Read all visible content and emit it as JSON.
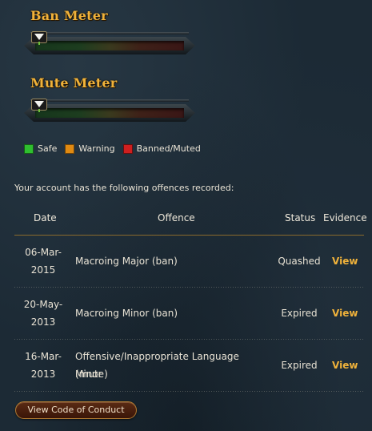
{
  "ban_meter": {
    "title": "Ban Meter",
    "level": 0
  },
  "mute_meter": {
    "title": "Mute Meter",
    "level": 0
  },
  "legend": [
    {
      "label": "Safe",
      "color": "#2fbf2f"
    },
    {
      "label": "Warning",
      "color": "#e08a12"
    },
    {
      "label": "Banned/Muted",
      "color": "#cf1f1f"
    }
  ],
  "intro_text": "Your account has the following offences recorded:",
  "table": {
    "headers": {
      "date": "Date",
      "offence": "Offence",
      "status": "Status",
      "evidence": "Evidence"
    },
    "rows": [
      {
        "date_line1": "06-Mar-",
        "date_line2": "2015",
        "offence_line1": "Macroing Major (ban)",
        "offence_line2": "",
        "status": "Quashed",
        "evidence": "View"
      },
      {
        "date_line1": "20-May-",
        "date_line2": "2013",
        "offence_line1": "Macroing Minor (ban)",
        "offence_line2": "",
        "status": "Expired",
        "evidence": "View"
      },
      {
        "date_line1": "16-Mar-",
        "date_line2": "2013",
        "offence_line1": "Offensive/Inappropriate Language Minor",
        "offence_line2": "(mute)",
        "status": "Expired",
        "evidence": "View"
      }
    ]
  },
  "code_of_conduct_button": "View Code of Conduct",
  "colors": {
    "accent": "#f0b23a",
    "link": "#f0b23a"
  }
}
